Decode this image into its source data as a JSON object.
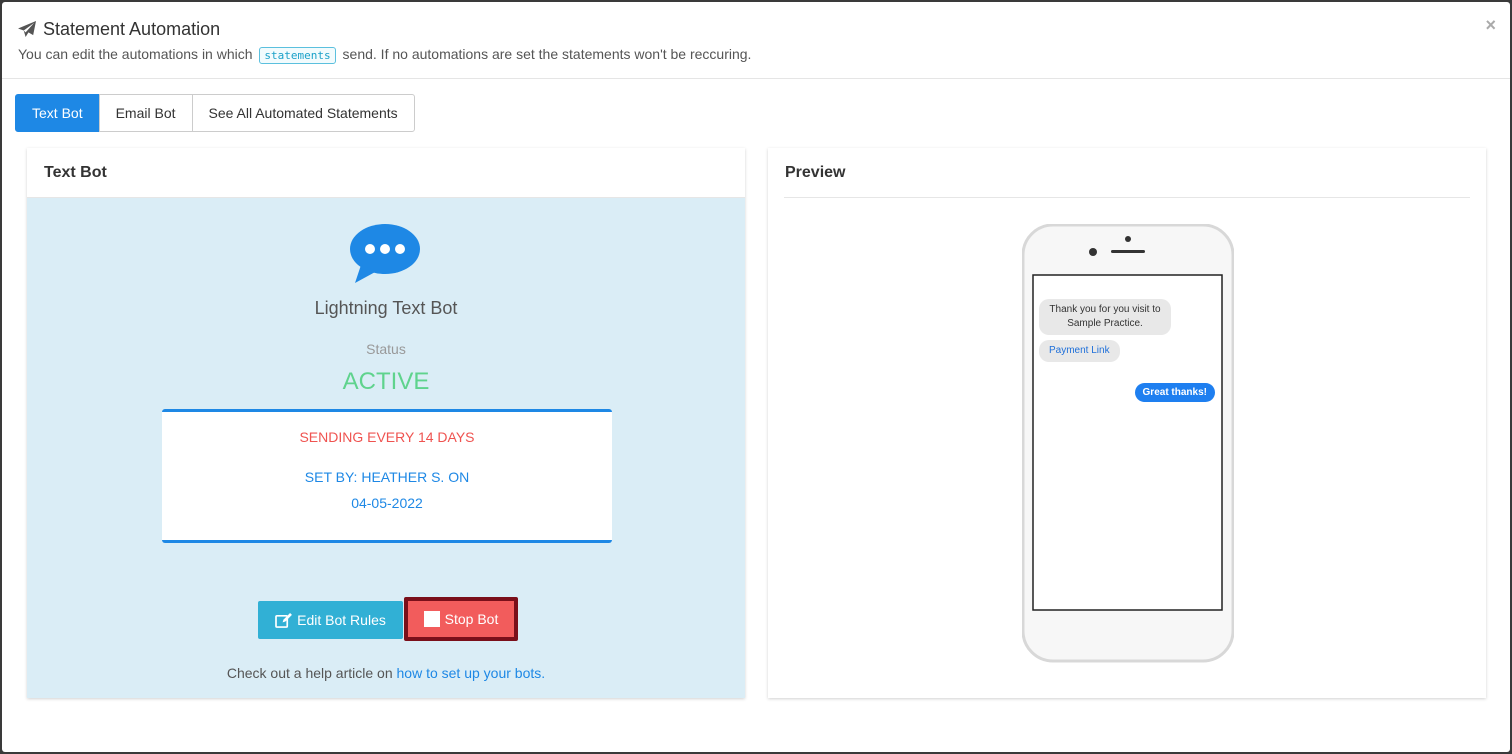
{
  "header": {
    "title": "Statement Automation",
    "sub_before": "You can edit the automations in which",
    "sub_code": "statements",
    "sub_after": "send. If no automations are set the statements won't be reccuring.",
    "close": "×"
  },
  "tabs": [
    {
      "label": "Text Bot",
      "active": true
    },
    {
      "label": "Email Bot",
      "active": false
    },
    {
      "label": "See All Automated Statements",
      "active": false
    }
  ],
  "text_bot": {
    "heading": "Text Bot",
    "name": "Lightning Text Bot",
    "status_label": "Status",
    "status_value": "ACTIVE",
    "sending": "SENDING EVERY 14 DAYS",
    "set_by": "SET BY: HEATHER S. ON",
    "set_date": "04-05-2022",
    "edit_label": "Edit Bot Rules",
    "stop_label": "Stop Bot",
    "help_text": "Check out a help article on",
    "help_link": "how to set up your bots."
  },
  "preview": {
    "heading": "Preview",
    "msg_in": "Thank you for you visit to Sample Practice.",
    "msg_link": "Payment Link",
    "msg_out": "Great thanks!"
  },
  "colors": {
    "primary": "#1e88e5",
    "active": "#5fd38d",
    "danger": "#ef5350",
    "info": "#31b0d5",
    "panel_bg": "#daedf6"
  },
  "icons": [
    "paper-plane-icon",
    "close-icon",
    "chat-bubble-icon",
    "edit-icon",
    "stop-icon"
  ]
}
